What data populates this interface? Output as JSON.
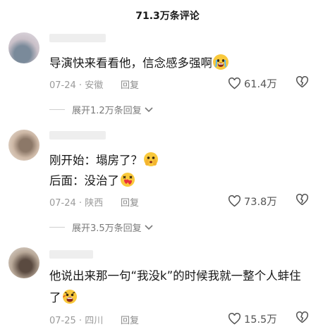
{
  "header": {
    "title": "71.3万条评论"
  },
  "comments": [
    {
      "text": "导演快来看看他，信念感多强啊",
      "date": "07-24",
      "location": "安徽",
      "reply_label": "回复",
      "likes": "61.4万",
      "expand_label": "展开1.2万条回复",
      "emoji": "crying-face",
      "avatar_colors": [
        "#c9c0c8",
        "#7a8a9a",
        "#d8d2da"
      ]
    },
    {
      "lines": [
        "刚开始：塌房了？",
        "后面：没治了"
      ],
      "date": "07-24",
      "location": "陕西",
      "reply_label": "回复",
      "likes": "73.8万",
      "expand_label": "展开3.5万条回复",
      "emoji": [
        "peeking-face",
        "melting-heart-face"
      ],
      "avatar_colors": [
        "#e6d8c8",
        "#8c7868",
        "#cdb8a6"
      ]
    },
    {
      "lines": [
        "他说出来那一句“我没k”的时候我就一整个人蚌住",
        "了"
      ],
      "date": "07-25",
      "location": "四川",
      "reply_label": "回复",
      "likes": "15.5万",
      "emoji": "shocked-face",
      "avatar_colors": [
        "#d8d2cc",
        "#5a4a40",
        "#b8a898"
      ]
    }
  ],
  "colors": {
    "text": "#161616",
    "meta": "#9a9a9a",
    "like_icon": "#555555"
  }
}
